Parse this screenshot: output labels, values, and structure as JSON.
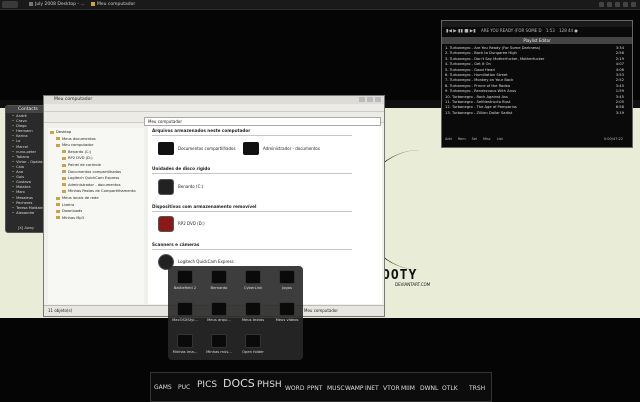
{
  "taskbar": {
    "start_label": "",
    "tasks": [
      "July 2008 Desktop - ...",
      "Meu computador"
    ]
  },
  "contacts": {
    "title": "Contacts",
    "items": [
      "André",
      "Cravo",
      "Diego",
      "Hermann",
      "Karina",
      "Lo",
      "Marcel",
      "nuno-peter",
      "Tatiana",
      "Victor - Opalas",
      "Caio",
      "Ana",
      "Gois",
      "Gustavo",
      "Malabra",
      "Marx",
      "Mesaleus",
      "Pecheres",
      "Teresa Maldaleira",
      "Alexandre"
    ],
    "footer": "[X] Away"
  },
  "explorer": {
    "title": "Meu computador",
    "address": "Meu computador",
    "tree": [
      "Desktop",
      "Meus documentos",
      "Meu computador",
      "Benardo (C:)",
      "RP2 DVD (D:)",
      "Painel de controle",
      "Documentos compartilhados",
      "Logitech QuickCam Express",
      "Administrador - documentos",
      "Minhas Pastas de Compartilhamento",
      "Meus locais de rede",
      "Lixeira",
      "Downloads",
      "Minhas Mp3"
    ],
    "sections": {
      "files": "Arquivos armazenados neste computador",
      "hard": "Unidades de disco rígido",
      "removable": "Dispositivos com armazenamento removível",
      "scanners": "Scanners e câmeras"
    },
    "items": {
      "shared_docs": "Documentos compartilhados",
      "admin_docs": "Administrador - documentos",
      "drive_c": "Benardo (C:)",
      "drive_d": "RP2 DVD (D:)",
      "webcam": "Logitech QuickCam Express"
    },
    "status_left": "11 objeto(s)",
    "status_right": "Meu computador"
  },
  "player": {
    "time_display": "1:53",
    "meta": "128 44 ●",
    "now_playing": "ARE YOU READY (FOR SOME D",
    "playlist_title": "Playlist Editor",
    "tracks": [
      {
        "t": "1. Turbonegro - Are You Ready (For Some Darkness)",
        "d": "3:34"
      },
      {
        "t": "2. Turbonegro - Back to Dungaree High",
        "d": "2:56"
      },
      {
        "t": "3. Turbonegro - Don't Say Motherfucker, Motherfucker",
        "d": "2:19"
      },
      {
        "t": "4. Turbonegro - Get It On",
        "d": "4:07"
      },
      {
        "t": "5. Turbonegro - Good Head",
        "d": "4:06"
      },
      {
        "t": "6. Turbonegro - Humiliation Street",
        "d": "3:53"
      },
      {
        "t": "7. Turbonegro - Monkey on Your Back",
        "d": "2:52"
      },
      {
        "t": "8. Turbonegro - Prince of the Rodeo",
        "d": "3:45"
      },
      {
        "t": "9. Turbonegro - Rendezvous With Anus",
        "d": "1:59"
      },
      {
        "t": "10. Turbonegro - Rock Against Ass",
        "d": "3:45"
      },
      {
        "t": "11. Turbonegro - Selfdestructo Bust",
        "d": "2:05"
      },
      {
        "t": "12. Turbonegro - The Age of Pamparius",
        "d": "6:58"
      },
      {
        "t": "13. Turbonegro - Zillion Dollar Sadist",
        "d": "3:19"
      }
    ],
    "buttons": [
      "Add",
      "Rem",
      "Sel",
      "Misc",
      "List"
    ],
    "total_time": "0:00/47:22"
  },
  "launcher": {
    "tiles": [
      "Battlefield 2",
      "Bernardo",
      "CyberLink",
      "Jogos",
      "MacOSXStyl...",
      "Meus arqui...",
      "Meus textos",
      "Meus vídeos",
      "Minhas ima...",
      "Minhas mús...",
      "Open folder"
    ]
  },
  "dock": {
    "items": [
      "GAMS",
      "PUC",
      "PICS",
      "DOCS",
      "PHSH",
      "WORD",
      "PPNT",
      "MUSC",
      "WAMP",
      "INET",
      "VTOR",
      "MIIM",
      "DWNL",
      "OTLK",
      "TRSH"
    ]
  },
  "wallpaper": {
    "brand": "OOTY",
    "brand_sub": "DEVIANTART.COM"
  }
}
